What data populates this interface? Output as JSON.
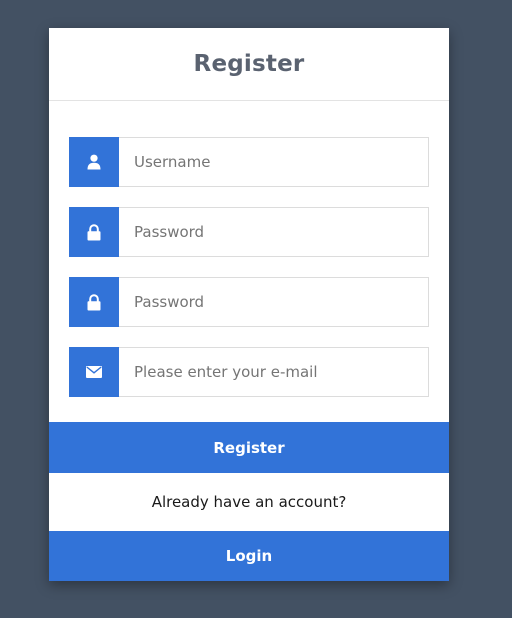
{
  "colors": {
    "background": "#435163",
    "card": "#ffffff",
    "accent": "#3273d8",
    "title": "#5a6270"
  },
  "form": {
    "title": "Register",
    "fields": [
      {
        "icon": "user-icon",
        "placeholder": "Username",
        "value": ""
      },
      {
        "icon": "lock-icon",
        "placeholder": "Password",
        "value": ""
      },
      {
        "icon": "lock-icon",
        "placeholder": "Password",
        "value": ""
      },
      {
        "icon": "envelope-icon",
        "placeholder": "Please enter your e-mail",
        "value": ""
      }
    ],
    "register_label": "Register",
    "account_prompt": "Already have an account?",
    "login_label": "Login"
  }
}
